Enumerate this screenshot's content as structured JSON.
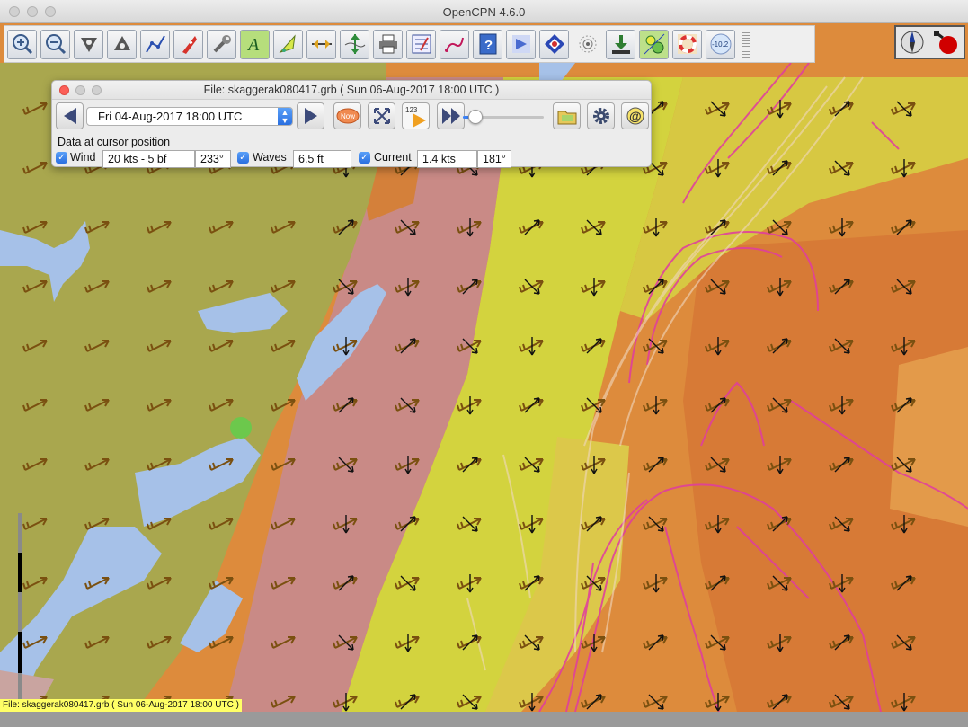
{
  "window": {
    "title": "OpenCPN 4.6.0"
  },
  "colors": {
    "land": "#a9a74e",
    "water_blue": "#a6c1e8",
    "zone_yellow": "#d3d33e",
    "zone_orange": "#dd8b3c",
    "zone_pink": "#c98a86",
    "current_line": "#e03ca0",
    "arrow_brown": "#7a5010"
  },
  "toolbar": {
    "buttons": [
      {
        "name": "zoom-in-button",
        "icon": "zoom-in-icon"
      },
      {
        "name": "zoom-out-button",
        "icon": "zoom-out-icon"
      },
      {
        "name": "scale-in-button",
        "icon": "scale-in-icon"
      },
      {
        "name": "scale-out-button",
        "icon": "scale-out-icon"
      },
      {
        "name": "route-button",
        "icon": "route-icon"
      },
      {
        "name": "auto-follow-button",
        "icon": "ship-icon"
      },
      {
        "name": "settings-button",
        "icon": "wrench-icon"
      },
      {
        "name": "text-button",
        "icon": "text-icon"
      },
      {
        "name": "current-button",
        "icon": "current-icon"
      },
      {
        "name": "tide-button",
        "icon": "tide-icon"
      },
      {
        "name": "depth-button",
        "icon": "depth-icon"
      },
      {
        "name": "print-button",
        "icon": "printer-icon"
      },
      {
        "name": "route-manager-button",
        "icon": "checklist-icon"
      },
      {
        "name": "track-button",
        "icon": "track-icon"
      },
      {
        "name": "help-button",
        "icon": "help-icon"
      },
      {
        "name": "ais-button",
        "icon": "ais-icon"
      },
      {
        "name": "mob-button",
        "icon": "mob-icon"
      },
      {
        "name": "sound-button",
        "icon": "sound-icon"
      },
      {
        "name": "download-button",
        "icon": "download-icon"
      },
      {
        "name": "grib-button",
        "icon": "grib-icon"
      },
      {
        "name": "buoy-button",
        "icon": "lifebuoy-icon"
      },
      {
        "name": "tide-gauge-button",
        "icon": "tide-gauge-icon"
      }
    ],
    "tide_gauge_value": "-10.2"
  },
  "grib": {
    "title": "File: skaggerak080417.grb ( Sun 06-Aug-2017 18:00  UTC )",
    "time_selected": "Fri 04-Aug-2017 18:00  UTC",
    "now_label": "Now",
    "numbers_label": "123",
    "slider_value": 0.15,
    "cursor_label": "Data at cursor position",
    "wind": {
      "label": "Wind",
      "speed": "20 kts -  5 bf",
      "direction": "233°"
    },
    "waves": {
      "label": "Waves",
      "height": "6.5 ft"
    },
    "current": {
      "label": "Current",
      "speed": "1.4 kts",
      "direction": "181°"
    }
  },
  "status": {
    "text": "File: skaggerak080417.grb ( Sun 06-Aug-2017 18:00  UTC )"
  }
}
